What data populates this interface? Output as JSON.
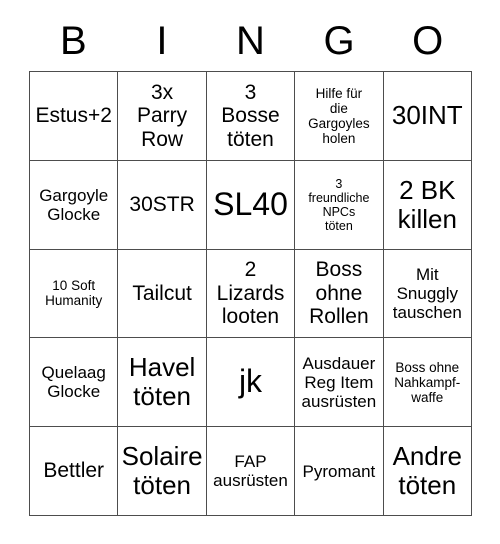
{
  "card": {
    "header_letters": [
      "B",
      "I",
      "N",
      "G",
      "O"
    ],
    "rows": [
      [
        {
          "text": "Estus+2",
          "size": "md"
        },
        {
          "text": "3x\nParry\nRow",
          "size": "md"
        },
        {
          "text": "3\nBosse\ntöten",
          "size": "md"
        },
        {
          "text": "Hilfe für\ndie\nGargoyles\nholen",
          "size": "xs"
        },
        {
          "text": "30INT",
          "size": "lg"
        }
      ],
      [
        {
          "text": "Gargoyle\nGlocke",
          "size": "sm"
        },
        {
          "text": "30STR",
          "size": "md"
        },
        {
          "text": "SL40",
          "size": "xl"
        },
        {
          "text": "3\nfreundliche\nNPCs\ntöten",
          "size": "xxs"
        },
        {
          "text": "2 BK\nkillen",
          "size": "lg"
        }
      ],
      [
        {
          "text": "10 Soft\nHumanity",
          "size": "xs"
        },
        {
          "text": "Tailcut",
          "size": "md"
        },
        {
          "text": "2\nLizards\nlooten",
          "size": "md"
        },
        {
          "text": "Boss\nohne\nRollen",
          "size": "md"
        },
        {
          "text": "Mit\nSnuggly\ntauschen",
          "size": "sm"
        }
      ],
      [
        {
          "text": "Quelaag\nGlocke",
          "size": "sm"
        },
        {
          "text": "Havel\ntöten",
          "size": "lg"
        },
        {
          "text": "jk",
          "size": "xl"
        },
        {
          "text": "Ausdauer\nReg Item\nausrüsten",
          "size": "sm"
        },
        {
          "text": "Boss ohne\nNahkampf-\nwaffe",
          "size": "xs"
        }
      ],
      [
        {
          "text": "Bettler",
          "size": "md"
        },
        {
          "text": "Solaire\ntöten",
          "size": "lg"
        },
        {
          "text": "FAP\nausrüsten",
          "size": "sm"
        },
        {
          "text": "Pyromant",
          "size": "sm"
        },
        {
          "text": "Andre\ntöten",
          "size": "lg"
        }
      ]
    ]
  },
  "colors": {
    "background": "#ffffff",
    "text": "#000000",
    "border": "#4d4d4d"
  }
}
